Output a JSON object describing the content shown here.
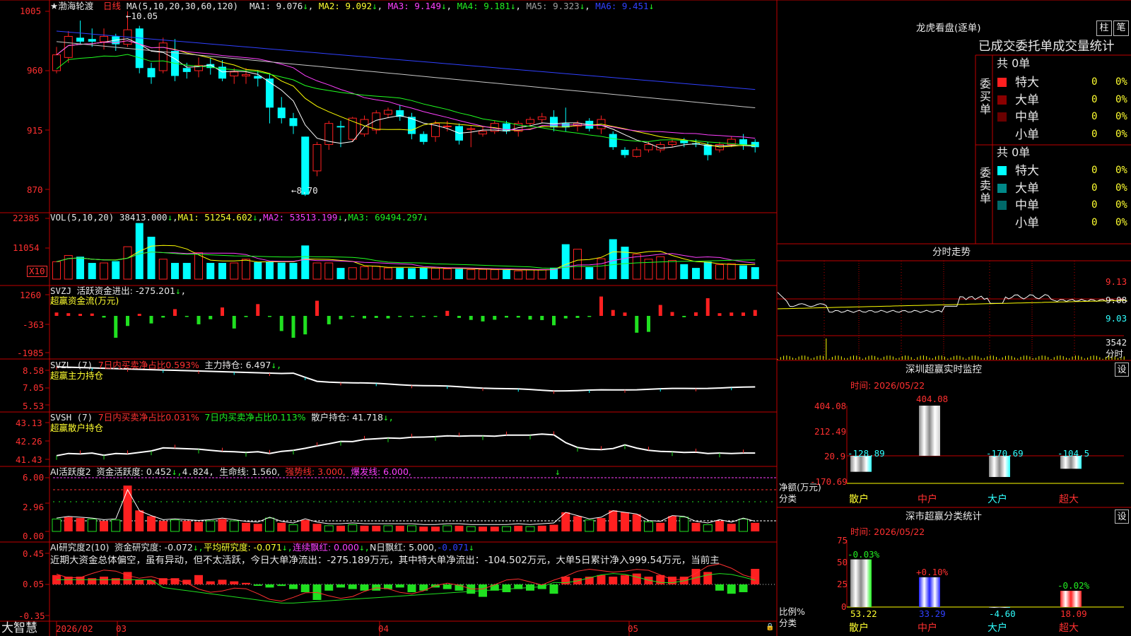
{
  "stock": {
    "name": "★渤海轮渡",
    "period": "日线"
  },
  "colors": {
    "up": "#ff2020",
    "down": "#00ffff",
    "grid": "#c00000",
    "ma1": "#ffffff",
    "ma2": "#ffff00",
    "ma3": "#ff40ff",
    "ma4": "#20ff20",
    "ma5": "#c8c8c8",
    "ma6": "#3040ff"
  },
  "kline": {
    "legend": {
      "prefix": "MA(5,10,20,30,60,120)",
      "ma1": "MA1: 9.076",
      "ma1a": "↓",
      "ma2": "MA2: 9.092",
      "ma2a": "↓",
      "ma3": "MA3: 9.149",
      "ma3a": "↓",
      "ma4": "MA4: 9.181",
      "ma4a": "↓",
      "ma5": "MA5: 9.323",
      "ma5a": "↓",
      "ma6": "MA6: 9.451",
      "ma6a": "↓"
    },
    "yticks": [
      "1005",
      "960",
      "915",
      "870"
    ],
    "high_label": "←10.05",
    "low_label": "←8.70"
  },
  "vol": {
    "prefix": "VOL(5,10,20)",
    "v": "38413.000",
    "va": "↓",
    "ma1": "MA1: 51254.602",
    "ma1a": "↓",
    "ma2": "MA2: 53513.199",
    "ma2a": "↓",
    "ma3": "MA3: 69494.297",
    "ma3a": "↓",
    "yticks": [
      "22385",
      "11054"
    ],
    "unit": "X10"
  },
  "svzj": {
    "prefix": "SVZJ",
    "t1": "活跃资金进出: -275.201",
    "t1a": "↓",
    "title": "超赢资金流(万元)",
    "yticks": [
      "1260",
      "-363",
      "-1985"
    ]
  },
  "svzl": {
    "prefix": "SVZL (7)",
    "t1": "7日内买卖净占比0.593%",
    "t2": "主力持仓: 6.497",
    "t2a": "↓,",
    "title": "超赢主力持仓",
    "yticks": [
      "8.58",
      "7.05",
      "5.53"
    ]
  },
  "svsh": {
    "prefix": "SVSH (7)",
    "t1": "7日内买卖净占比0.031%",
    "t2": "7日内买卖净占比0.113%",
    "t3": "散户持仓: 41.718",
    "t3a": "↓,",
    "title": "超赢散户持仓",
    "yticks": [
      "43.13",
      "42.26",
      "41.43"
    ]
  },
  "ai1": {
    "prefix": "AI活跃度2",
    "t1": "资金活跃度: 0.452",
    "t1a": "↓,",
    "t2": "4.824,",
    "t3": "生命线: 1.560,",
    "t4": "强势线: 3.000,",
    "t5": "爆发线: 6.000,",
    "arrow": "↓",
    "yticks": [
      "6.00",
      "2.96",
      "0.00"
    ]
  },
  "ai2": {
    "prefix": "AI研究度2(10)",
    "t1": "资金研究度: -0.072",
    "t1a": "↓,",
    "t2": "平均研究度: -0.071",
    "t2a": "↓,",
    "t3": "连续飘红: 0.000",
    "t3a": "↓,",
    "t4": "N日飘红: 5.000,",
    "t5": "-0.071",
    "t5a": "↓",
    "note": "近期大资金总体偏空，虽有异动，但不太活跃，今日大单净流出：-275.189万元，其中特大单净流出：-104.502万元，大单5日累计净入999.54万元，当前主",
    "yticks": [
      "0.45",
      "0.05",
      "-0.35"
    ]
  },
  "xaxis": {
    "brand": "大智慧",
    "labels": [
      "2026/02",
      "03",
      "04",
      "05"
    ]
  },
  "lhb": {
    "title": "龙虎看盘(逐单)",
    "btn1": "柱",
    "btn2": "笔",
    "header": "已成交委托单成交量统计",
    "buy": {
      "label": "委买单",
      "total": "共 0单",
      "rows": [
        {
          "name": "特大",
          "val": "0",
          "pct": "0%",
          "color": "#ff2020"
        },
        {
          "name": "大单",
          "val": "0",
          "pct": "0%",
          "color": "#8a0000"
        },
        {
          "name": "中单",
          "val": "0",
          "pct": "0%",
          "color": "#6a0000"
        },
        {
          "name": "小单",
          "val": "0",
          "pct": "0%",
          "color": "#000000"
        }
      ]
    },
    "sell": {
      "label": "委卖单",
      "total": "共 0单",
      "rows": [
        {
          "name": "特大",
          "val": "0",
          "pct": "0%",
          "color": "#00ffff"
        },
        {
          "name": "大单",
          "val": "0",
          "pct": "0%",
          "color": "#008888"
        },
        {
          "name": "中单",
          "val": "0",
          "pct": "0%",
          "color": "#006a6a"
        },
        {
          "name": "小单",
          "val": "0",
          "pct": "0%",
          "color": "#000000"
        }
      ]
    }
  },
  "fenshi": {
    "title": "分时走势",
    "yticks": [
      "9.13",
      "9.08",
      "9.03"
    ],
    "vol_label": "3542",
    "vol_unit": "分时"
  },
  "sz_monitor": {
    "title": "深圳超赢实时监控",
    "btn": "设",
    "time": "时间: 2026/05/22",
    "yticks": [
      "404.08",
      "212.49",
      "20.9",
      "-170.69"
    ],
    "ylabel": "净额(万元)",
    "xlabel": "分类",
    "chart_data": {
      "type": "bar",
      "categories": [
        "散户",
        "中户",
        "大户",
        "超大"
      ],
      "values": [
        -128.89,
        404.08,
        -170.69,
        -104.5
      ],
      "value_labels": [
        "-128.89",
        "404.08",
        "-170.69",
        "-104.5"
      ],
      "ylim": [
        -170.69,
        404.08
      ]
    }
  },
  "sz_class": {
    "title": "深市超赢分类统计",
    "btn": "设",
    "time": "时间: 2026/05/22",
    "yticks": [
      "75",
      "50",
      "25",
      "0"
    ],
    "ylabel": "比例%",
    "xlabel": "分类",
    "chart_data": {
      "type": "bar",
      "categories": [
        "散户",
        "中户",
        "大户",
        "超大"
      ],
      "values": [
        53.22,
        33.29,
        -4.6,
        18.09
      ],
      "value_labels": [
        "53.22",
        "33.29",
        "-4.60",
        "18.09"
      ],
      "change_labels": [
        "-0.03%",
        "+0.10%",
        "",
        "-0.02%"
      ],
      "ylim": [
        0,
        75
      ]
    }
  }
}
